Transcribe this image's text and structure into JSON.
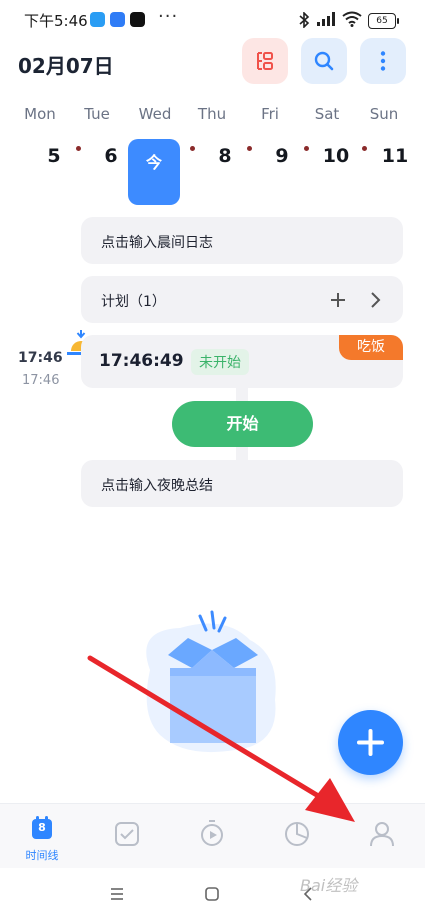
{
  "status_bar": {
    "time": "下午5:46",
    "dots": "···",
    "battery": "65"
  },
  "header": {
    "date": "02月07日"
  },
  "week": {
    "days": [
      "Mon",
      "Tue",
      "Wed",
      "Thu",
      "Fri",
      "Sat",
      "Sun"
    ],
    "dates": [
      "5",
      "6",
      "",
      "8",
      "9",
      "10",
      "11"
    ],
    "today_label": "今"
  },
  "morning_log": {
    "placeholder": "点击输入晨间日志"
  },
  "plan": {
    "label": "计划（1）"
  },
  "entry": {
    "start_time": "17:46",
    "end_time": "17:46",
    "time": "17:46:49",
    "status": "未开始",
    "tag": "吃饭"
  },
  "start_button": {
    "label": "开始"
  },
  "evening_summary": {
    "placeholder": "点击输入夜晚总结"
  },
  "bottom_nav": {
    "items": [
      {
        "icon": "calendar-icon",
        "label": "时间线",
        "badge": "8",
        "active": true
      },
      {
        "icon": "checkbox-icon",
        "label": "",
        "active": false
      },
      {
        "icon": "timer-icon",
        "label": "",
        "active": false
      },
      {
        "icon": "pie-chart-icon",
        "label": "",
        "active": false
      },
      {
        "icon": "user-icon",
        "label": "",
        "active": false
      }
    ]
  },
  "watermark": "Bai经验",
  "colors": {
    "accent": "#2f86ff",
    "start": "#3dbb74",
    "tag": "#f4792b",
    "status": "#3bb36a"
  }
}
